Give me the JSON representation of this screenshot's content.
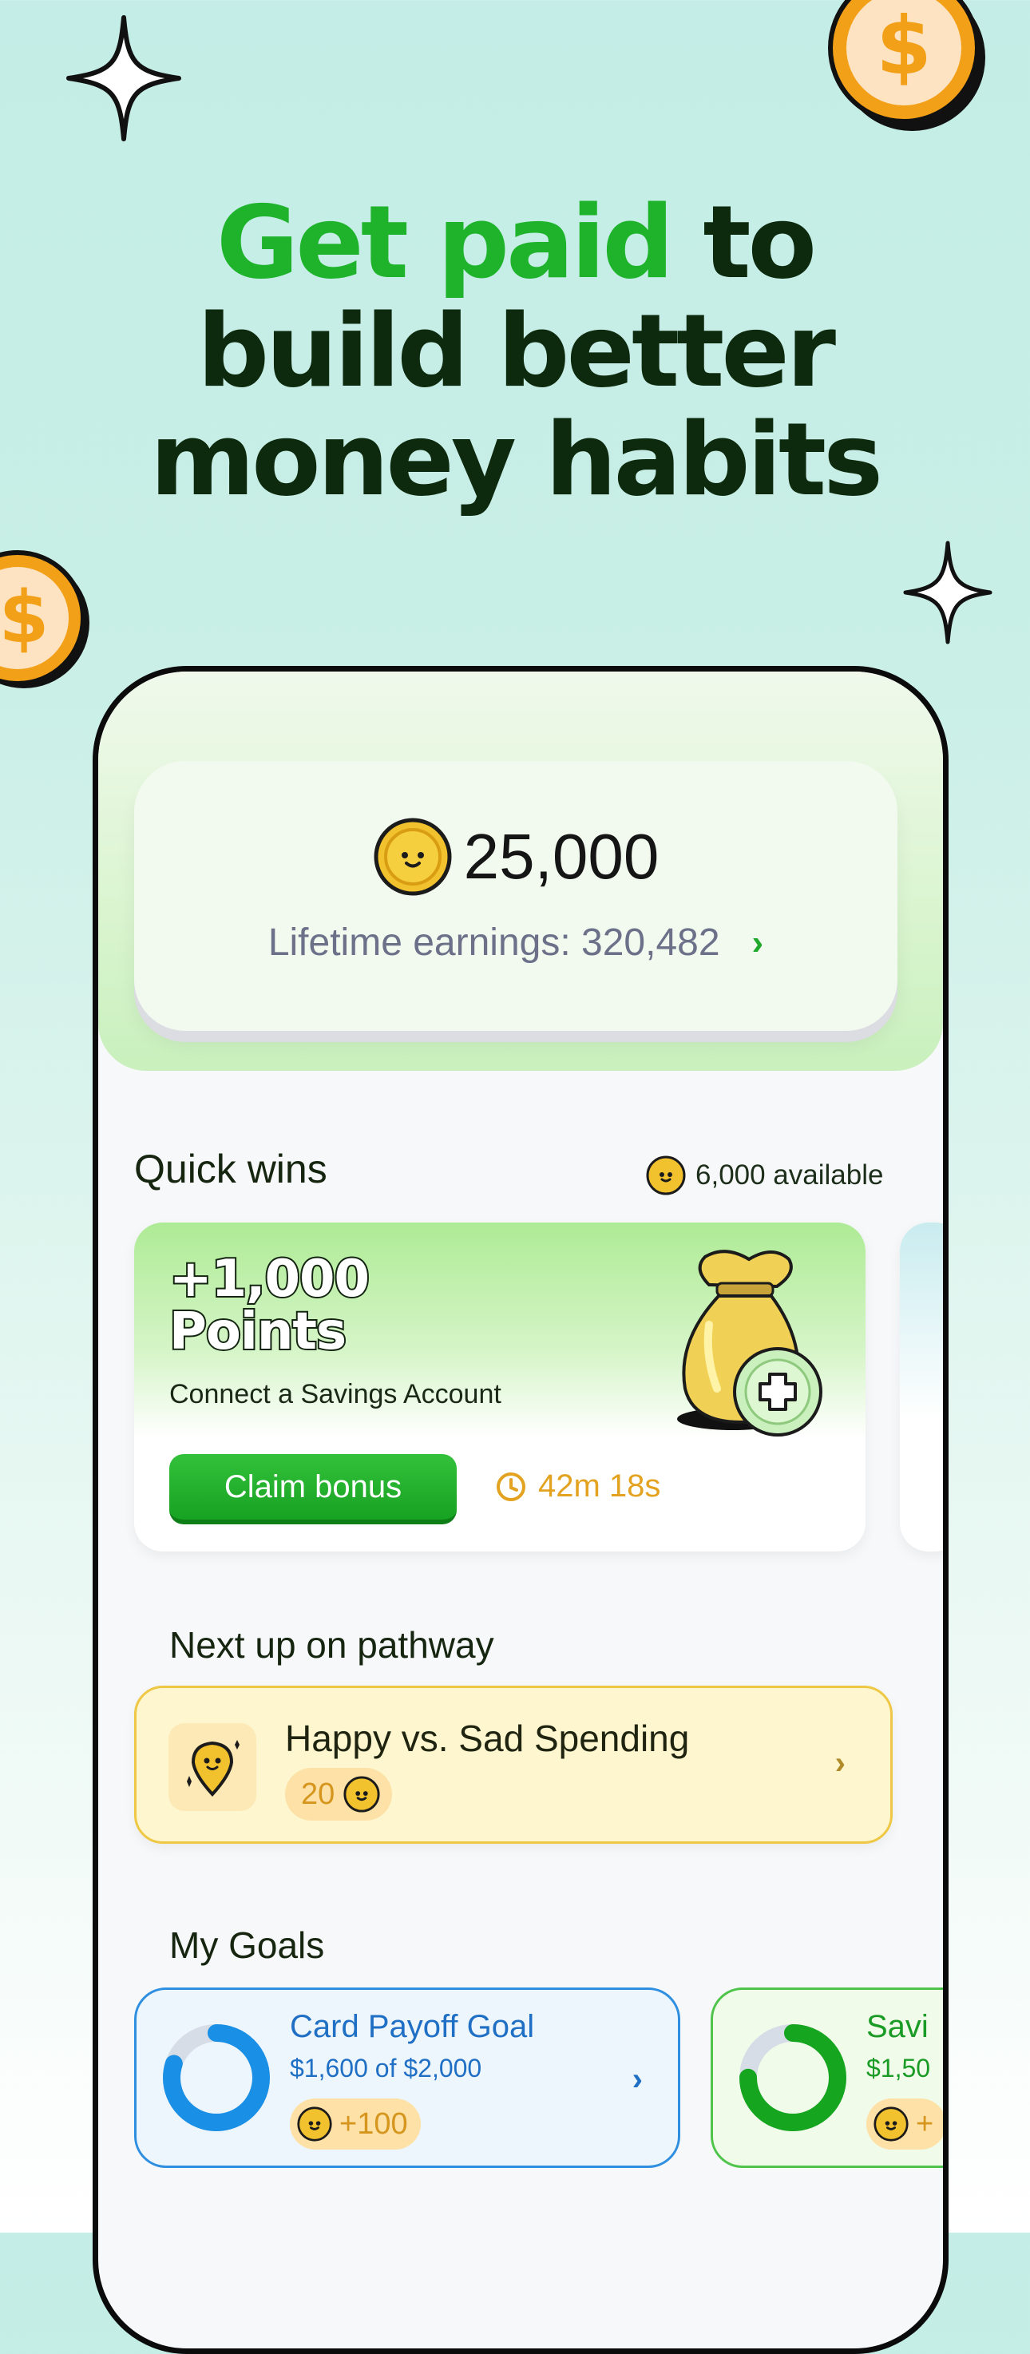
{
  "headline": {
    "accent": "Get paid",
    "line1_rest": "to",
    "line2": "build better",
    "line3": "money habits"
  },
  "balance": {
    "value": "25,000",
    "lifetime_label": "Lifetime earnings: 320,482"
  },
  "quick_wins": {
    "title": "Quick wins",
    "available": "6,000 available",
    "card": {
      "points_line1": "+1,000",
      "points_line2": "Points",
      "subtitle": "Connect a Savings Account",
      "button": "Claim bonus",
      "timer": "42m 18s"
    }
  },
  "pathway": {
    "title": "Next up on pathway",
    "item_title": "Happy vs. Sad Spending",
    "item_points": "20"
  },
  "goals": {
    "title": "My Goals",
    "items": [
      {
        "name": "Card Payoff Goal",
        "amount": "$1,600 of $2,000",
        "reward": "+100",
        "progress": 0.8
      },
      {
        "name": "Savi",
        "amount": "$1,50",
        "reward": "+",
        "progress": 0.75
      }
    ]
  },
  "colors": {
    "accent_green": "#1fb32c",
    "dark_text": "#0e2a0e",
    "coin_gold": "#f2c12e",
    "blue": "#2e8fe0",
    "timer": "#e3a321"
  }
}
